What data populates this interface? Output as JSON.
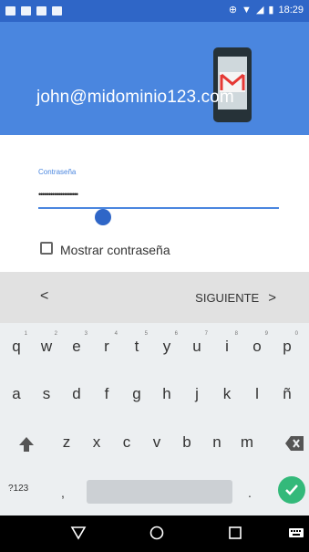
{
  "status_bar": {
    "time": "18:29"
  },
  "account": {
    "email": "john@midominio123.com"
  },
  "form": {
    "password_label": "Contraseña",
    "password_value": "••••••••••••••••••••",
    "show_password_label": "Mostrar contraseña"
  },
  "nav_row": {
    "prev": "<",
    "next": "SIGUIENTE",
    "next_chev": ">"
  },
  "keyboard": {
    "row1": [
      "q",
      "w",
      "e",
      "r",
      "t",
      "y",
      "u",
      "i",
      "o",
      "p"
    ],
    "row1_hints": [
      "1",
      "2",
      "3",
      "4",
      "5",
      "6",
      "7",
      "8",
      "9",
      "0"
    ],
    "row2": [
      "a",
      "s",
      "d",
      "f",
      "g",
      "h",
      "j",
      "k",
      "l",
      "ñ"
    ],
    "row3": [
      "z",
      "x",
      "c",
      "v",
      "b",
      "n",
      "m"
    ],
    "symbols": "?123",
    "comma": ",",
    "period": "."
  },
  "colors": {
    "header": "#4a86df",
    "status": "#2f66c7",
    "accent": "#2f66c7",
    "confirm": "#33b97a"
  }
}
